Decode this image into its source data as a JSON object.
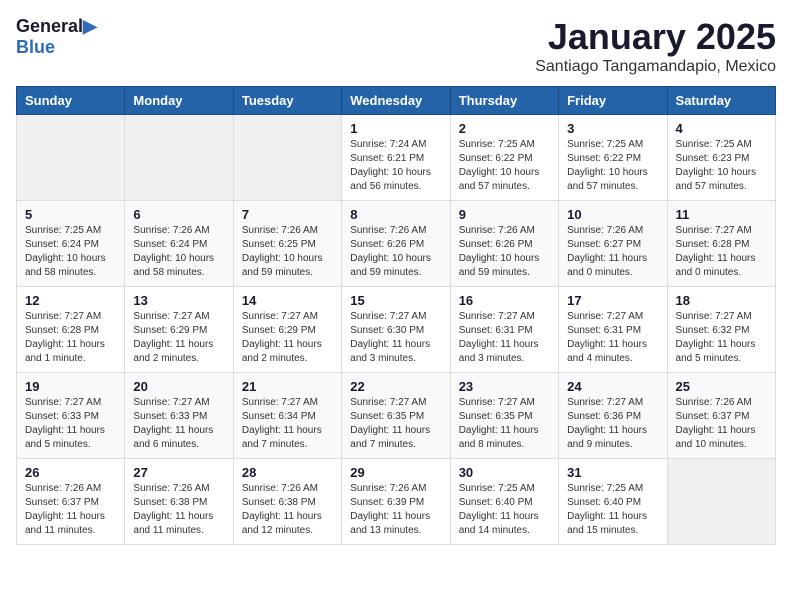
{
  "logo": {
    "general": "General",
    "blue": "Blue"
  },
  "title": {
    "month_year": "January 2025",
    "location": "Santiago Tangamandapio, Mexico"
  },
  "weekdays": [
    "Sunday",
    "Monday",
    "Tuesday",
    "Wednesday",
    "Thursday",
    "Friday",
    "Saturday"
  ],
  "weeks": [
    [
      {
        "day": "",
        "info": ""
      },
      {
        "day": "",
        "info": ""
      },
      {
        "day": "",
        "info": ""
      },
      {
        "day": "1",
        "info": "Sunrise: 7:24 AM\nSunset: 6:21 PM\nDaylight: 10 hours\nand 56 minutes."
      },
      {
        "day": "2",
        "info": "Sunrise: 7:25 AM\nSunset: 6:22 PM\nDaylight: 10 hours\nand 57 minutes."
      },
      {
        "day": "3",
        "info": "Sunrise: 7:25 AM\nSunset: 6:22 PM\nDaylight: 10 hours\nand 57 minutes."
      },
      {
        "day": "4",
        "info": "Sunrise: 7:25 AM\nSunset: 6:23 PM\nDaylight: 10 hours\nand 57 minutes."
      }
    ],
    [
      {
        "day": "5",
        "info": "Sunrise: 7:25 AM\nSunset: 6:24 PM\nDaylight: 10 hours\nand 58 minutes."
      },
      {
        "day": "6",
        "info": "Sunrise: 7:26 AM\nSunset: 6:24 PM\nDaylight: 10 hours\nand 58 minutes."
      },
      {
        "day": "7",
        "info": "Sunrise: 7:26 AM\nSunset: 6:25 PM\nDaylight: 10 hours\nand 59 minutes."
      },
      {
        "day": "8",
        "info": "Sunrise: 7:26 AM\nSunset: 6:26 PM\nDaylight: 10 hours\nand 59 minutes."
      },
      {
        "day": "9",
        "info": "Sunrise: 7:26 AM\nSunset: 6:26 PM\nDaylight: 10 hours\nand 59 minutes."
      },
      {
        "day": "10",
        "info": "Sunrise: 7:26 AM\nSunset: 6:27 PM\nDaylight: 11 hours\nand 0 minutes."
      },
      {
        "day": "11",
        "info": "Sunrise: 7:27 AM\nSunset: 6:28 PM\nDaylight: 11 hours\nand 0 minutes."
      }
    ],
    [
      {
        "day": "12",
        "info": "Sunrise: 7:27 AM\nSunset: 6:28 PM\nDaylight: 11 hours\nand 1 minute."
      },
      {
        "day": "13",
        "info": "Sunrise: 7:27 AM\nSunset: 6:29 PM\nDaylight: 11 hours\nand 2 minutes."
      },
      {
        "day": "14",
        "info": "Sunrise: 7:27 AM\nSunset: 6:29 PM\nDaylight: 11 hours\nand 2 minutes."
      },
      {
        "day": "15",
        "info": "Sunrise: 7:27 AM\nSunset: 6:30 PM\nDaylight: 11 hours\nand 3 minutes."
      },
      {
        "day": "16",
        "info": "Sunrise: 7:27 AM\nSunset: 6:31 PM\nDaylight: 11 hours\nand 3 minutes."
      },
      {
        "day": "17",
        "info": "Sunrise: 7:27 AM\nSunset: 6:31 PM\nDaylight: 11 hours\nand 4 minutes."
      },
      {
        "day": "18",
        "info": "Sunrise: 7:27 AM\nSunset: 6:32 PM\nDaylight: 11 hours\nand 5 minutes."
      }
    ],
    [
      {
        "day": "19",
        "info": "Sunrise: 7:27 AM\nSunset: 6:33 PM\nDaylight: 11 hours\nand 5 minutes."
      },
      {
        "day": "20",
        "info": "Sunrise: 7:27 AM\nSunset: 6:33 PM\nDaylight: 11 hours\nand 6 minutes."
      },
      {
        "day": "21",
        "info": "Sunrise: 7:27 AM\nSunset: 6:34 PM\nDaylight: 11 hours\nand 7 minutes."
      },
      {
        "day": "22",
        "info": "Sunrise: 7:27 AM\nSunset: 6:35 PM\nDaylight: 11 hours\nand 7 minutes."
      },
      {
        "day": "23",
        "info": "Sunrise: 7:27 AM\nSunset: 6:35 PM\nDaylight: 11 hours\nand 8 minutes."
      },
      {
        "day": "24",
        "info": "Sunrise: 7:27 AM\nSunset: 6:36 PM\nDaylight: 11 hours\nand 9 minutes."
      },
      {
        "day": "25",
        "info": "Sunrise: 7:26 AM\nSunset: 6:37 PM\nDaylight: 11 hours\nand 10 minutes."
      }
    ],
    [
      {
        "day": "26",
        "info": "Sunrise: 7:26 AM\nSunset: 6:37 PM\nDaylight: 11 hours\nand 11 minutes."
      },
      {
        "day": "27",
        "info": "Sunrise: 7:26 AM\nSunset: 6:38 PM\nDaylight: 11 hours\nand 11 minutes."
      },
      {
        "day": "28",
        "info": "Sunrise: 7:26 AM\nSunset: 6:38 PM\nDaylight: 11 hours\nand 12 minutes."
      },
      {
        "day": "29",
        "info": "Sunrise: 7:26 AM\nSunset: 6:39 PM\nDaylight: 11 hours\nand 13 minutes."
      },
      {
        "day": "30",
        "info": "Sunrise: 7:25 AM\nSunset: 6:40 PM\nDaylight: 11 hours\nand 14 minutes."
      },
      {
        "day": "31",
        "info": "Sunrise: 7:25 AM\nSunset: 6:40 PM\nDaylight: 11 hours\nand 15 minutes."
      },
      {
        "day": "",
        "info": ""
      }
    ]
  ]
}
